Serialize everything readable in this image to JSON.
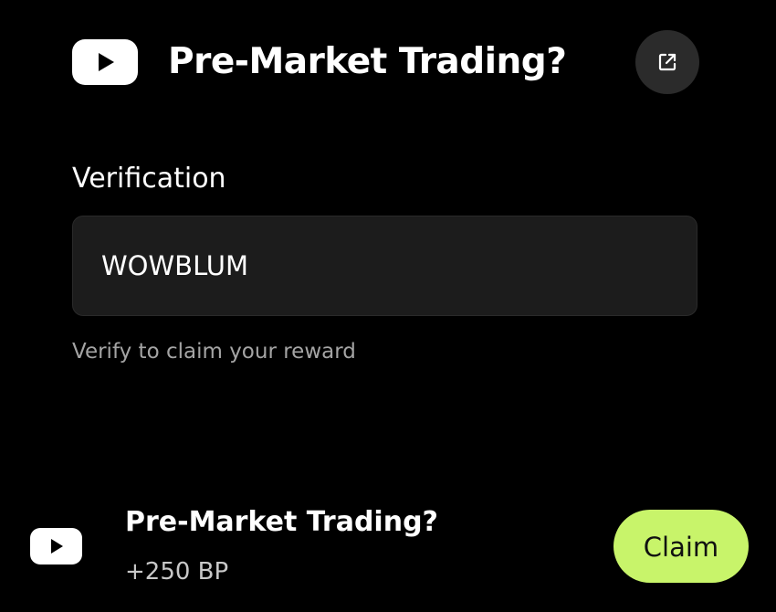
{
  "header": {
    "logo_icon": "youtube-play-icon",
    "title": "Pre-Market Trading?",
    "external_icon": "external-link-icon"
  },
  "verification": {
    "label": "Verification",
    "code_value": "WOWBLUM",
    "hint": "Verify to claim your reward"
  },
  "task": {
    "icon": "youtube-play-icon",
    "title": "Pre-Market Trading?",
    "reward": "+250 BP",
    "claim_label": "Claim"
  },
  "colors": {
    "background": "#000000",
    "field_background": "#1c1c1c",
    "button_background": "#2b2b2b",
    "claim_accent": "#c8f46a",
    "hint_text": "#a4a4a4"
  }
}
